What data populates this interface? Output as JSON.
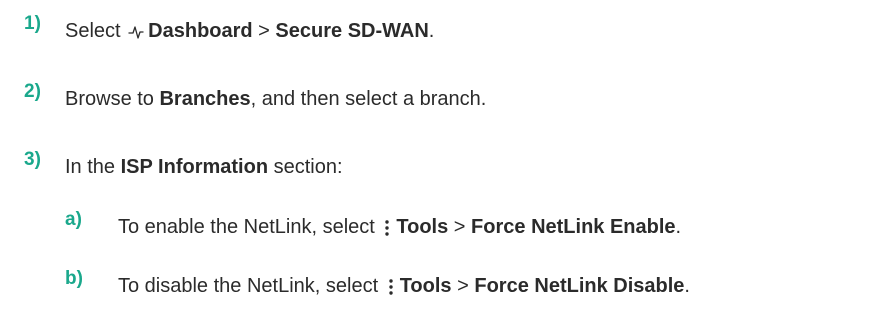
{
  "steps": [
    {
      "number": "1)",
      "prefix": "Select ",
      "icon": "activity-pulse-icon",
      "item1": "Dashboard",
      "sep": " > ",
      "item2": "Secure SD-WAN",
      "suffix": "."
    },
    {
      "number": "2)",
      "prefix": "Browse to ",
      "item1": "Branches",
      "suffix": ", and then select a branch."
    },
    {
      "number": "3)",
      "prefix": "In the ",
      "item1": "ISP Information",
      "suffix": " section:",
      "substeps": [
        {
          "number": "a)",
          "prefix": "To enable the NetLink, select ",
          "icon": "more-vertical-icon",
          "item1": "Tools",
          "sep": " > ",
          "item2": "Force NetLink Enable",
          "suffix": "."
        },
        {
          "number": "b)",
          "prefix": "To disable the NetLink, select ",
          "icon": "more-vertical-icon",
          "item1": "Tools",
          "sep": " > ",
          "item2": "Force NetLink Disable",
          "suffix": "."
        }
      ]
    }
  ],
  "colors": {
    "step_number": "#1aa88c",
    "text": "#2b2b2b",
    "background": "#ffffff"
  }
}
